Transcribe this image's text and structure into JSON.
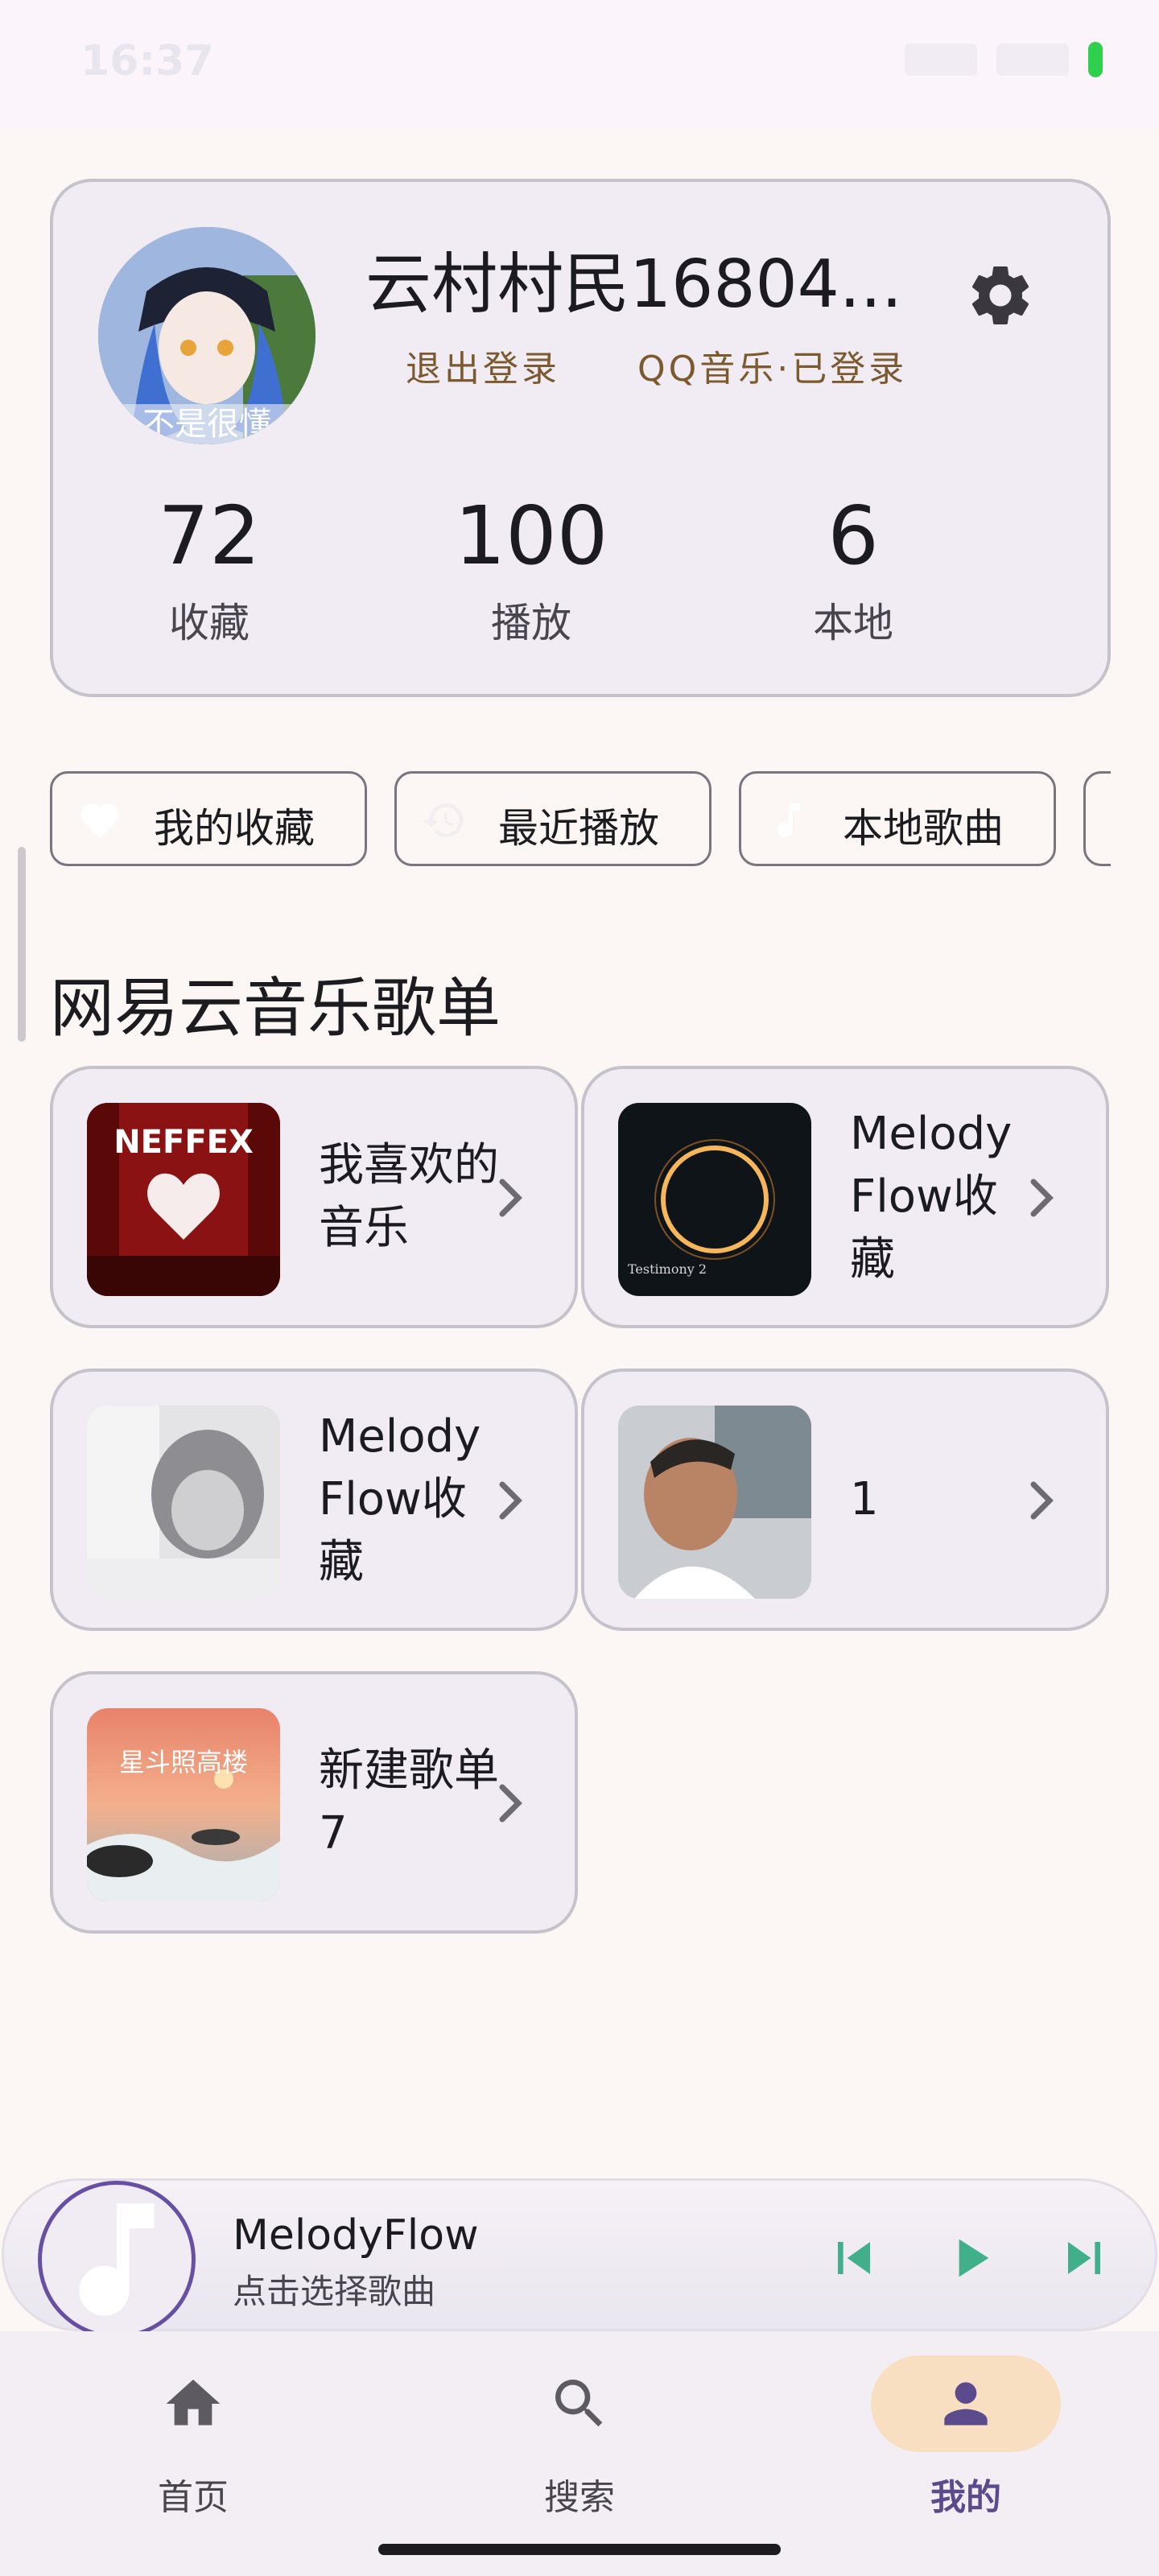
{
  "status_bar": {
    "time": "16:37"
  },
  "profile": {
    "avatar_caption": "不是很懂",
    "username": "云村村民16804...",
    "logout": "退出登录",
    "qq_status": "QQ音乐·已登录",
    "stats": [
      {
        "value": "72",
        "label": "收藏"
      },
      {
        "value": "100",
        "label": "播放"
      },
      {
        "value": "6",
        "label": "本地"
      }
    ]
  },
  "chips": [
    {
      "label": "我的收藏",
      "icon": "heart-icon"
    },
    {
      "label": "最近播放",
      "icon": "history-icon"
    },
    {
      "label": "本地歌曲",
      "icon": "music-note-icon"
    }
  ],
  "section_title": "网易云音乐歌单",
  "playlists": [
    {
      "name": "我喜欢的音乐",
      "cover_text": "NEFFEX"
    },
    {
      "name": "MelodyFlow收藏",
      "cover_text": "Testimony 2"
    },
    {
      "name": "MelodyFlow收藏",
      "cover_text": ""
    },
    {
      "name": "1",
      "cover_text": ""
    },
    {
      "name": "新建歌单7",
      "cover_text": "星斗照高楼"
    }
  ],
  "mini_player": {
    "title": "MelodyFlow",
    "subtitle": "点击选择歌曲"
  },
  "nav": [
    {
      "label": "首页",
      "icon": "home-icon"
    },
    {
      "label": "搜索",
      "icon": "search-icon"
    },
    {
      "label": "我的",
      "icon": "person-icon",
      "active": true
    }
  ],
  "colors": {
    "accent": "#5b4a8c",
    "play_green": "#41b08a",
    "link_brown": "#7a5a2e"
  }
}
